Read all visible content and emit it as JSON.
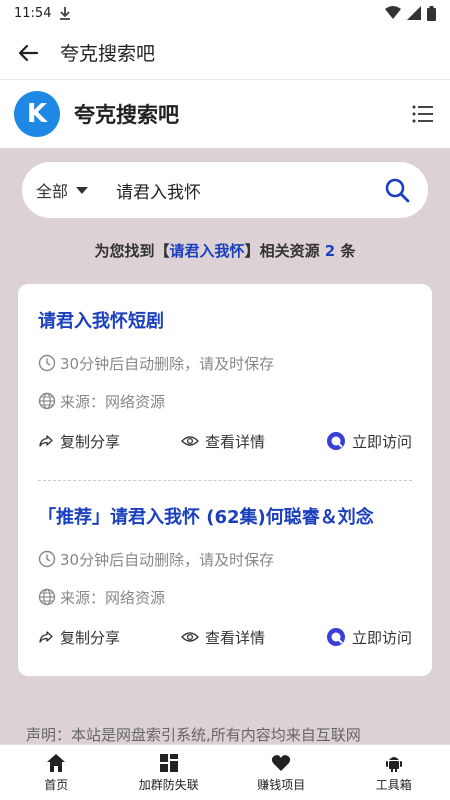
{
  "status_bar": {
    "time": "11:54"
  },
  "app_bar": {
    "title": "夸克搜索吧"
  },
  "site": {
    "logo_letter": "K",
    "name": "夸克搜索吧"
  },
  "search": {
    "scope": "全部",
    "query": "请君入我怀"
  },
  "result": {
    "prefix": "为您找到【",
    "keyword": "请君入我怀",
    "middle": "】相关资源 ",
    "count": "2",
    "suffix": " 条"
  },
  "results": [
    {
      "title": "请君入我怀短剧",
      "expire": "30分钟后自动删除，请及时保存",
      "source": "来源：网络资源",
      "share_label": "复制分享",
      "detail_label": "查看详情",
      "visit_label": "立即访问"
    },
    {
      "title": "「推荐」请君入我怀 (62集)何聪睿＆刘念",
      "expire": "30分钟后自动删除，请及时保存",
      "source": "来源：网络资源",
      "share_label": "复制分享",
      "detail_label": "查看详情",
      "visit_label": "立即访问"
    }
  ],
  "notice": "声明：本站是网盘索引系统,所有内容均来自互联网",
  "tabs": [
    {
      "label": "首页",
      "icon": "home-icon"
    },
    {
      "label": "加群防失联",
      "icon": "grid-icon"
    },
    {
      "label": "赚钱项目",
      "icon": "heart-icon"
    },
    {
      "label": "工具箱",
      "icon": "android-icon"
    }
  ],
  "colors": {
    "accent": "#1a3fbf",
    "logo": "#1e88e5",
    "background": "#dcd1d4"
  }
}
